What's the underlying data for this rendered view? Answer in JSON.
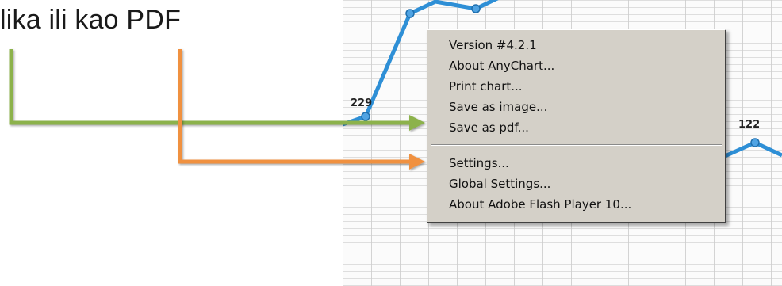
{
  "caption": {
    "text": "lika ili kao PDF"
  },
  "chart": {
    "line_color": "#2e8fd6",
    "label_229": "229",
    "label_122": "122"
  },
  "arrows": {
    "green": "#8cb24c",
    "orange": "#f0913f"
  },
  "context_menu": {
    "group1": [
      "Version #4.2.1",
      "About AnyChart...",
      "Print chart...",
      "Save as image...",
      "Save as pdf..."
    ],
    "group2": [
      "Settings...",
      "Global Settings...",
      "About Adobe Flash Player 10..."
    ]
  }
}
